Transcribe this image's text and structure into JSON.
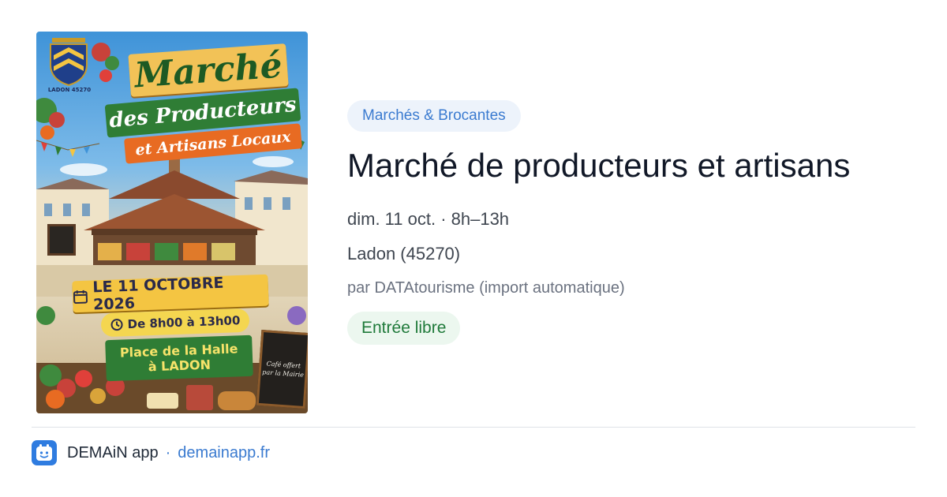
{
  "poster": {
    "title_line1": "Marché",
    "title_line2": "des Producteurs",
    "title_line3": "et Artisans Locaux",
    "crest_label": "LADON 45270",
    "date": "LE 11 OCTOBRE 2026",
    "time": "De 8h00 à 13h00",
    "place_line1": "Place de la Halle",
    "place_line2": "à LADON",
    "cafe_line1": "Café offert",
    "cafe_line2": "par la Mairie"
  },
  "event": {
    "category": "Marchés & Brocantes",
    "title": "Marché de producteurs et artisans",
    "datetime": "dim. 11 oct. · 8h–13h",
    "location": "Ladon (45270)",
    "source": "par DATAtourisme (import automatique)",
    "entry": "Entrée libre"
  },
  "footer": {
    "app_name": "DEMAiN app",
    "separator": "·",
    "link": "demainapp.fr",
    "icon": "app-logo-icon"
  },
  "colors": {
    "accent_blue": "#3b7bd0",
    "category_bg": "#edf3fb",
    "entry_green": "#1f7a3a",
    "entry_bg": "#ecf7ef"
  }
}
